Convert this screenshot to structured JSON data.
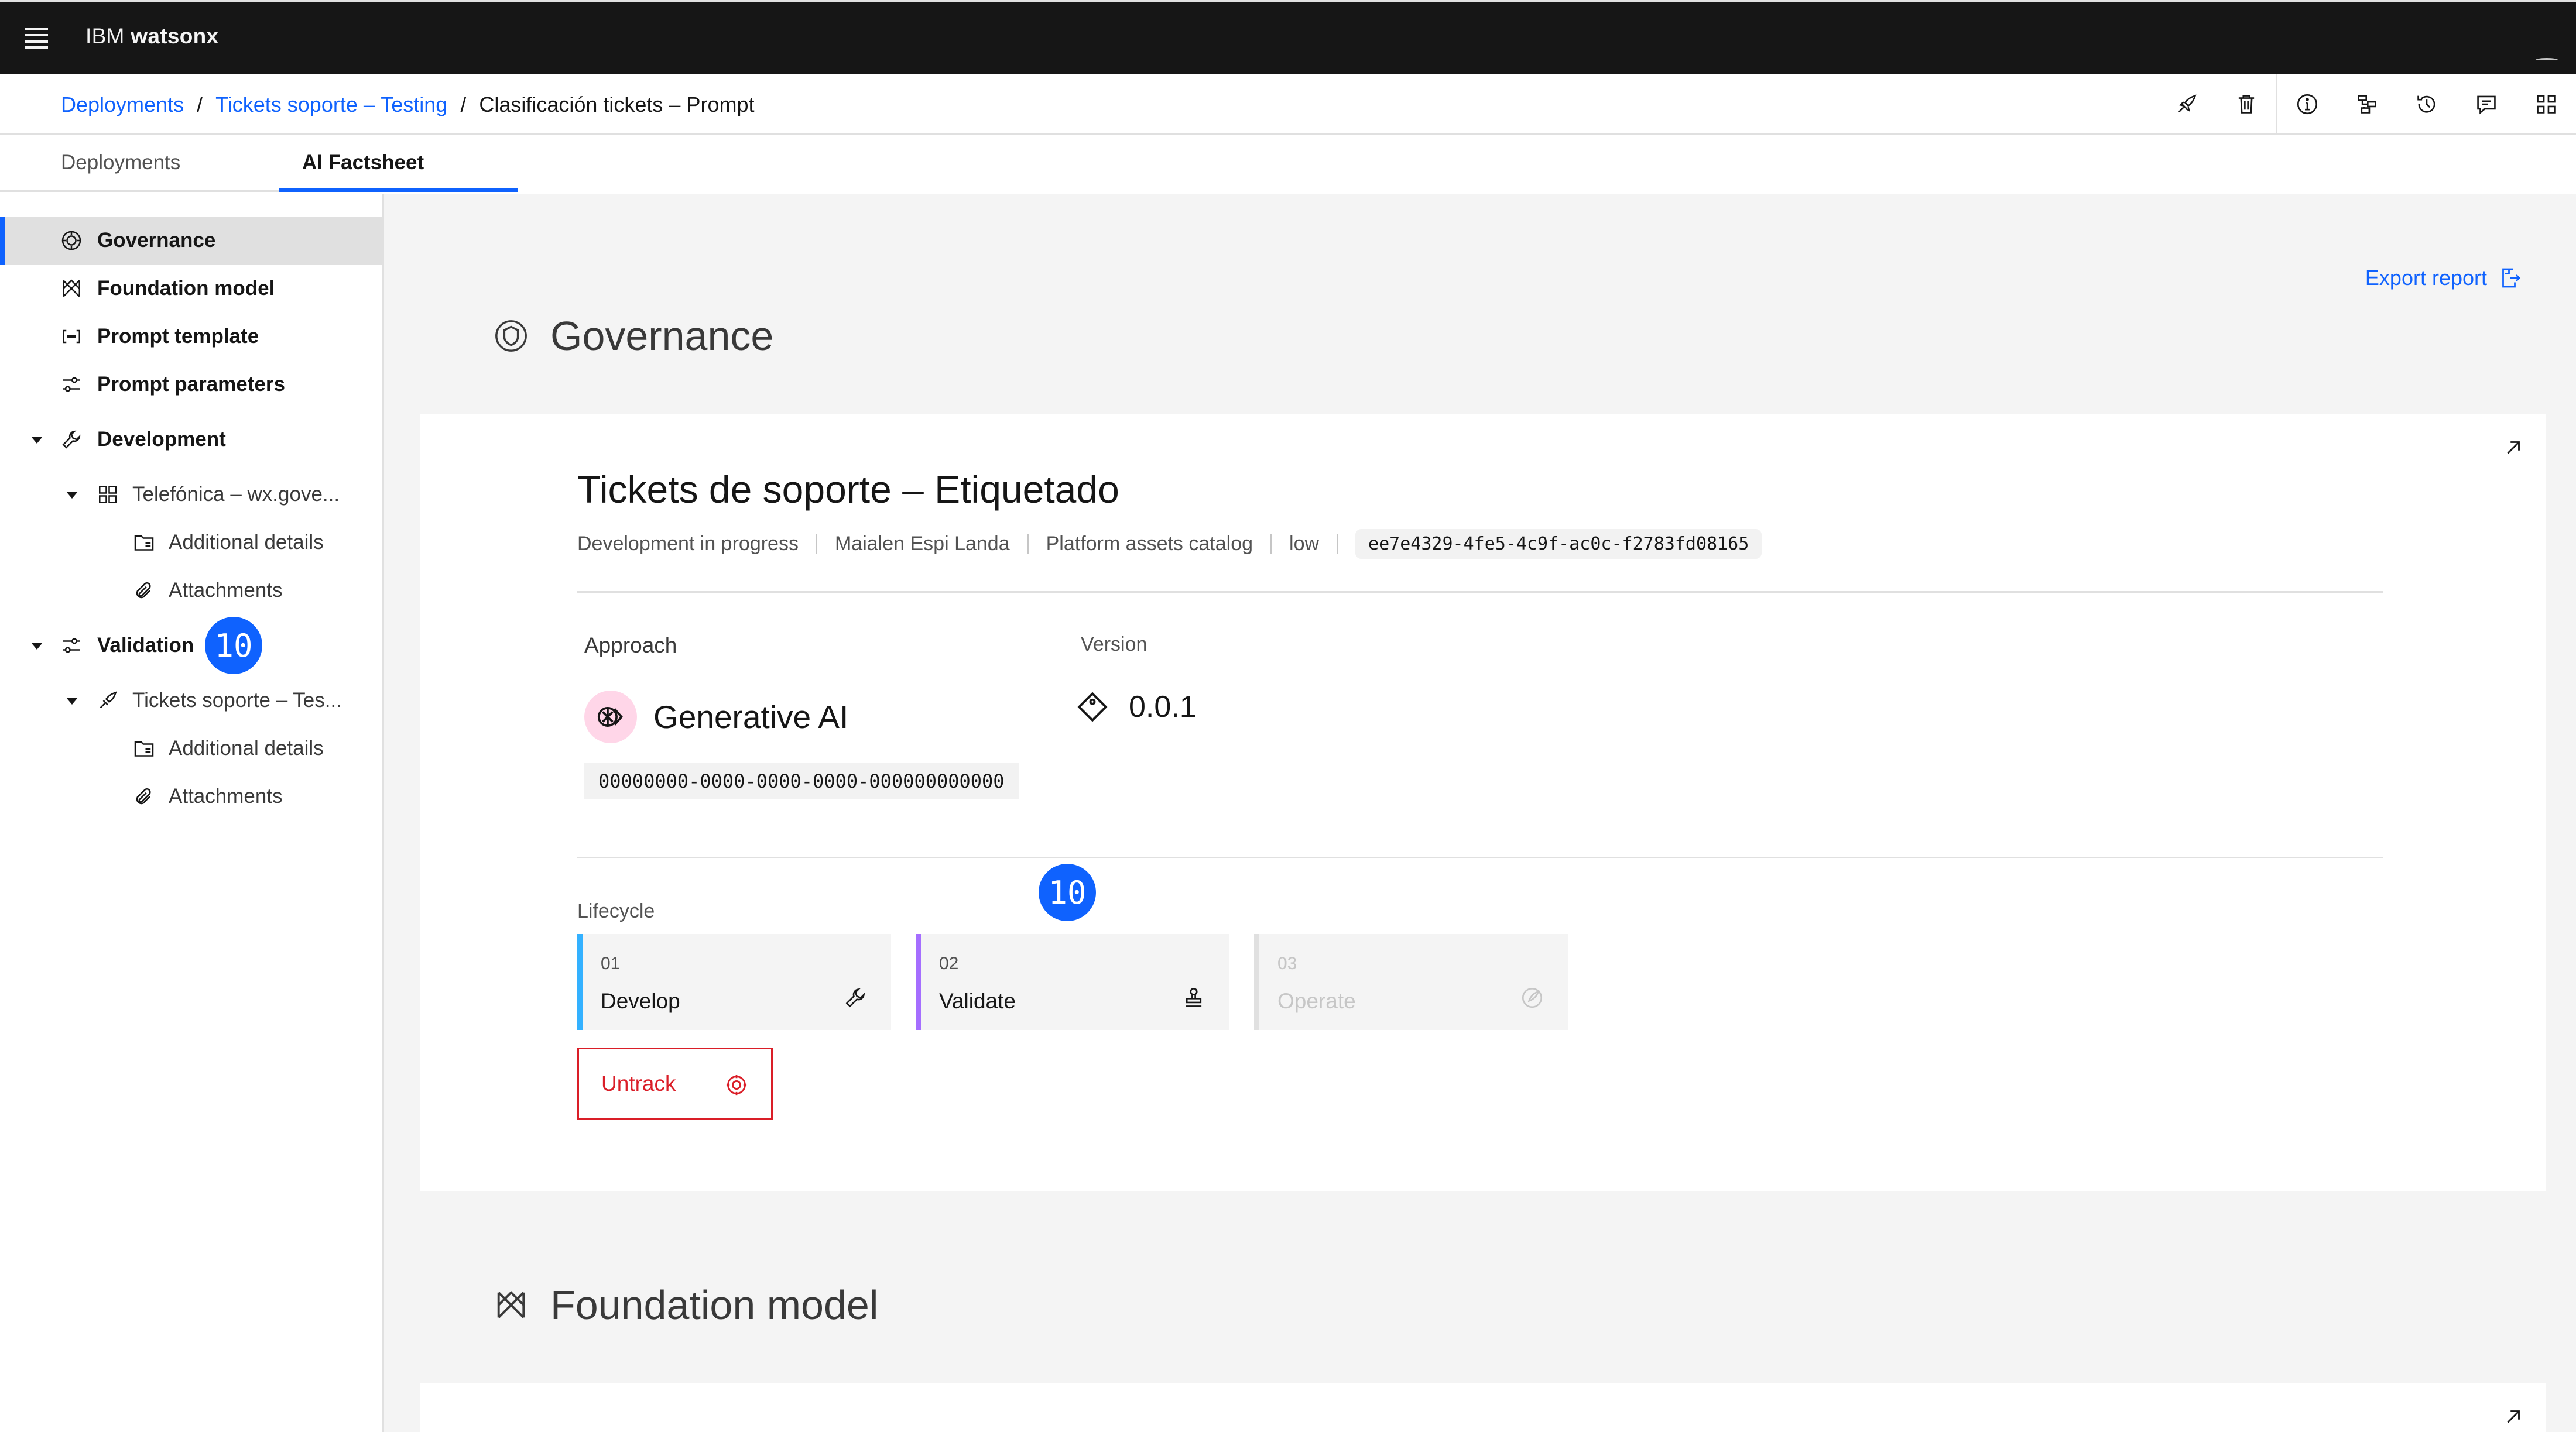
{
  "app": {
    "brand_prefix": "IBM ",
    "brand_name": "watsonx"
  },
  "breadcrumb": {
    "items": [
      "Deployments",
      "Tickets soporte – Testing"
    ],
    "current": "Clasificación tickets – Prompt",
    "separator": "/"
  },
  "toolbar": {
    "icons": [
      "deploy-icon",
      "trash-icon",
      "info-icon",
      "lineage-icon",
      "history-icon",
      "comment-icon",
      "apps-icon"
    ]
  },
  "tabs": [
    "Deployments",
    "AI Factsheet"
  ],
  "sidebar": {
    "governance": "Governance",
    "foundation_model": "Foundation model",
    "prompt_template": "Prompt template",
    "prompt_parameters": "Prompt parameters",
    "development": "Development",
    "dev_asset": "Telefónica – wx.gove...",
    "dev_additional": "Additional details",
    "dev_attachments": "Attachments",
    "validation": "Validation",
    "val_asset": "Tickets soporte – Tes...",
    "val_additional": "Additional details",
    "val_attachments": "Attachments"
  },
  "badges": {
    "sidebar_count": "10",
    "lifecycle_count": "10"
  },
  "main": {
    "export_label": "Export report",
    "governance_title": "Governance",
    "foundation_title": "Foundation model"
  },
  "governance_card": {
    "title": "Tickets de soporte – Etiquetado",
    "status": "Development in progress",
    "owner": "Maialen Espi Landa",
    "catalog": "Platform assets catalog",
    "risk": "low",
    "id": "ee7e4329-4fe5-4c9f-ac0c-f2783fd08165",
    "approach_label": "Approach",
    "approach_value": "Generative AI",
    "approach_id": "00000000-0000-0000-0000-000000000000",
    "version_label": "Version",
    "version_value": "0.0.1",
    "lifecycle_label": "Lifecycle",
    "untrack_label": "Untrack"
  },
  "lifecycle": [
    {
      "num": "01",
      "name": "Develop",
      "color": "#33b1ff",
      "icon": "wrench-icon"
    },
    {
      "num": "02",
      "name": "Validate",
      "color": "#a56eff",
      "icon": "stamp-icon"
    },
    {
      "num": "03",
      "name": "Operate",
      "color": "#e0e0e0",
      "icon": "rocket-icon"
    }
  ],
  "colors": {
    "accent": "#0f62fe",
    "danger": "#da1e28",
    "header_bg": "#161616"
  }
}
